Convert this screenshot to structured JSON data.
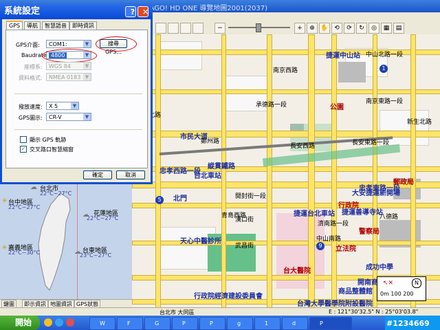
{
  "app": {
    "title_fragment": "PAPAGO! HD ONE 導覽地圖2001(2037)"
  },
  "dialog": {
    "title": "系統設定",
    "help_glyph": "?",
    "close_glyph": "✕",
    "tabs": [
      "GPS",
      "導航",
      "智慧語音",
      "即時資訊"
    ],
    "gps_interface_label": "GPS介面:",
    "gps_interface_value": "COM1:",
    "search_gps_button": "搜尋GPS...",
    "baudrate_label": "Baudrate:",
    "baudrate_value": "4800",
    "coord_label": "座標系:",
    "coord_value": "WGS 84",
    "format_label": "資料格式:",
    "format_value": "NMEA 0183",
    "speed_label": "撥放速度:",
    "speed_value": "X 5",
    "gps_display_label": "GPS圖示:",
    "gps_display_value": "CR-V",
    "checkbox_track_label": "顯示 GPS 軌跡",
    "checkbox_track_checked": false,
    "checkbox_intersection_label": "交叉路口智慧縮窗",
    "checkbox_intersection_checked": true,
    "ok_button": "確定",
    "cancel_button": "取消"
  },
  "weather": {
    "taipei": {
      "name": "台北市",
      "temp": "22°C~27°C"
    },
    "taichung": {
      "name": "台中地區",
      "temp": "22°C~27°C"
    },
    "hualien": {
      "name": "花蓮地區",
      "temp": "22°C~27°C"
    },
    "chiayi": {
      "name": "嘉義地區",
      "temp": "22°C~30°C"
    },
    "taitung": {
      "name": "台東地區",
      "temp": "23°C~27°C"
    }
  },
  "bottom_tabs": [
    "鍵圖",
    "即示資訊",
    "地圖資訊",
    "GPS狀態"
  ],
  "status": {
    "location": "台北市 大同區",
    "coords": "E : 121°30'32.5\"  N : 25°03'03.8\""
  },
  "watermark": "#1234669",
  "scale": {
    "label": "0m 100 200"
  },
  "map_labels": {
    "zhongshan_station": "捷運中山站",
    "chengde_rd": "承德路一段",
    "nanjing_w": "南京西路",
    "nanjing_e": "南京東路一段",
    "zhongshan_n": "中山北路一段",
    "huayin": "華陰街",
    "changan_w": "長安西路",
    "changan_e": "長安東路一段",
    "civic_blvd": "市民大道",
    "zhongxiao_w": "忠孝西路一段",
    "zhongxiao_e": "忠孝東路一段",
    "railway": "縱貫鐵路",
    "railway2": "鐵路地下化",
    "taipei_station": "台北車站",
    "ntu_hospital": "台大醫院",
    "legislative": "立法院",
    "executive": "行政院",
    "police": "警察局",
    "taipei_main_stn": "捷運台北車站",
    "shandao": "捷運善導寺站",
    "beimen": "北門",
    "tianxin": "天心中醫診所",
    "taiwan_uni_hosp": "台灣大學醫學院附設醫院",
    "gov_bldg": "行政院經濟建設委員會",
    "chengkung": "成功中學",
    "gongyuan": "公園",
    "zhongshan_s": "中山南路",
    "qingdao_w": "青島西路",
    "jinan": "濟南路一段",
    "bade": "八德路",
    "route_1": "1",
    "route_5": "5",
    "route_9": "9",
    "xinsheng": "新生北路",
    "chengdu": "大安捷運新開場",
    "kaifeng": "開封街一段",
    "hankou": "漢口街",
    "wuchang": "武昌街",
    "zhengzhou": "鄭州路",
    "yanping": "延平北路",
    "post": "郵政局",
    "school": "商品整體館",
    "kuaijie": "開南商工"
  }
}
